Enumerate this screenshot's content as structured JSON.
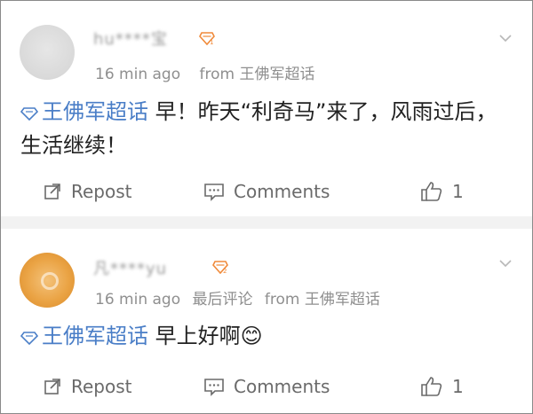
{
  "posts": [
    {
      "username": "hu****宝",
      "level_badge": "1",
      "meta": {
        "time": "16 min ago",
        "extra": "",
        "source": "from 王佛军超话"
      },
      "topic": "王佛军超话",
      "text": " 早！昨天“利奇马”来了，风雨过后，生活继续！",
      "emoji": "",
      "actions": {
        "repost": "Repost",
        "comments": "Comments",
        "likes": "1"
      }
    },
    {
      "username": "凡****yu",
      "level_badge": "2",
      "meta": {
        "time": "16 min ago",
        "extra": "最后评论",
        "source": "from 王佛军超话"
      },
      "topic": "王佛军超话",
      "text": " 早上好啊",
      "emoji": "😊",
      "actions": {
        "repost": "Repost",
        "comments": "Comments",
        "likes": "1"
      }
    }
  ],
  "icons": {
    "topic": "diamond-topic-icon",
    "repost": "repost-icon",
    "comments": "comment-icon",
    "like": "thumbs-up-icon",
    "more": "chevron-down-icon",
    "level": "level-badge-icon"
  },
  "colors": {
    "topic": "#4a7ec7",
    "level_badge": "#f08a3a",
    "separator": "#f2f2f2",
    "meta": "#8f8f8f",
    "action": "#6a6a6a"
  }
}
